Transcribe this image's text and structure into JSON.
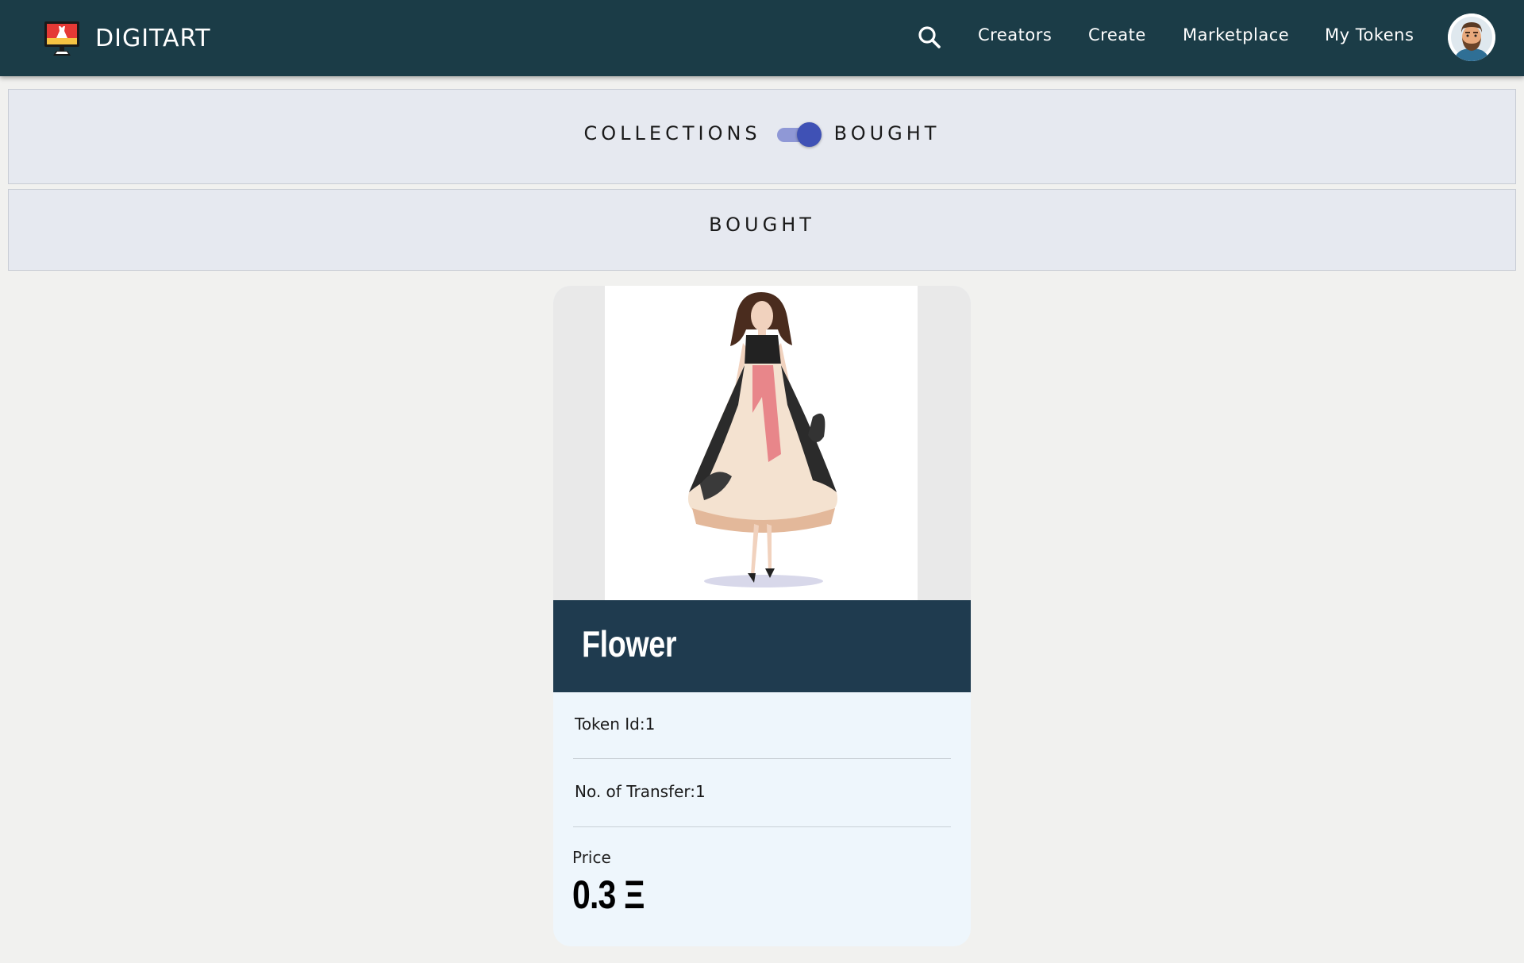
{
  "navbar": {
    "brand": "DIGITART",
    "links": {
      "creators": "Creators",
      "create": "Create",
      "marketplace": "Marketplace",
      "my_tokens": "My Tokens"
    },
    "icons": {
      "logo": "monitor-dress-logo",
      "search": "search-icon",
      "avatar": "user-avatar"
    },
    "background_color": "#1b3c47"
  },
  "toggle": {
    "left_label": "COLLECTIONS",
    "right_label": "BOUGHT",
    "state": "on",
    "accent_color": "#3f51b5"
  },
  "section": {
    "title": "BOUGHT"
  },
  "card": {
    "image": "fashion-illustration-dress",
    "name": "Flower",
    "token_id": "Token Id:1",
    "transfers": "No. of Transfer:1",
    "price_label": "Price",
    "price_value": "0.3 Ξ",
    "header_color": "#1f3b4f"
  }
}
